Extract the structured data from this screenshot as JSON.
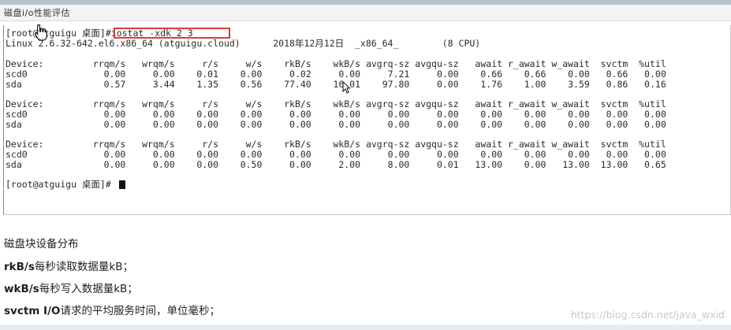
{
  "page": {
    "title": "磁盘i/o性能评估"
  },
  "terminal": {
    "prompt": "[root@atguigu 桌面]#",
    "command": "iostat -xdk 2 3",
    "system_info": "Linux 2.6.32-642.el6.x86_64 (atguigu.cloud)      2018年12月12日  _x86_64_        (8 CPU)",
    "reports": [
      {
        "header": "Device:         rrqm/s   wrqm/s     r/s     w/s    rkB/s    wkB/s avgrq-sz avgqu-sz   await r_await w_await  svctm  %util",
        "rows": [
          "scd0              0.00     0.00    0.01    0.00     0.02     0.00     7.21     0.00    0.66    0.66    0.00   0.66   0.00",
          "sda               0.57     3.44    1.35    0.56    77.40    16.01    97.80     0.00    1.76    1.00    3.59   0.86   0.16"
        ]
      },
      {
        "header": "Device:         rrqm/s   wrqm/s     r/s     w/s    rkB/s    wkB/s avgrq-sz avgqu-sz   await r_await w_await  svctm  %util",
        "rows": [
          "scd0              0.00     0.00    0.00    0.00     0.00     0.00     0.00     0.00    0.00    0.00    0.00   0.00   0.00",
          "sda               0.00     0.00    0.00    0.00     0.00     0.00     0.00     0.00    0.00    0.00    0.00   0.00   0.00"
        ]
      },
      {
        "header": "Device:         rrqm/s   wrqm/s     r/s     w/s    rkB/s    wkB/s avgrq-sz avgqu-sz   await r_await w_await  svctm  %util",
        "rows": [
          "scd0              0.00     0.00    0.00    0.00     0.00     0.00     0.00     0.00    0.00    0.00    0.00   0.00   0.00",
          "sda               0.00     0.00    0.00    0.50     0.00     2.00     8.00     0.01   13.00    0.00   13.00  13.00   0.65"
        ]
      }
    ],
    "final_prompt": "[root@atguigu 桌面]#"
  },
  "notes": [
    {
      "term": "",
      "text": "磁盘块设备分布"
    },
    {
      "term": "rkB/s",
      "text": "每秒读取数据量kB；"
    },
    {
      "term": "wkB/s",
      "text": "每秒写入数据量kB；"
    },
    {
      "term": "svctm I/O",
      "text": "请求的平均服务时间，单位毫秒；"
    }
  ],
  "watermark": "https://blog.csdn.net/java_wxid",
  "icons": {
    "pointer": "hand-pointer-icon",
    "arrow": "mouse-arrow-icon"
  },
  "colors": {
    "highlight": "#e03a3a",
    "topbar": "#b7c2cc"
  }
}
